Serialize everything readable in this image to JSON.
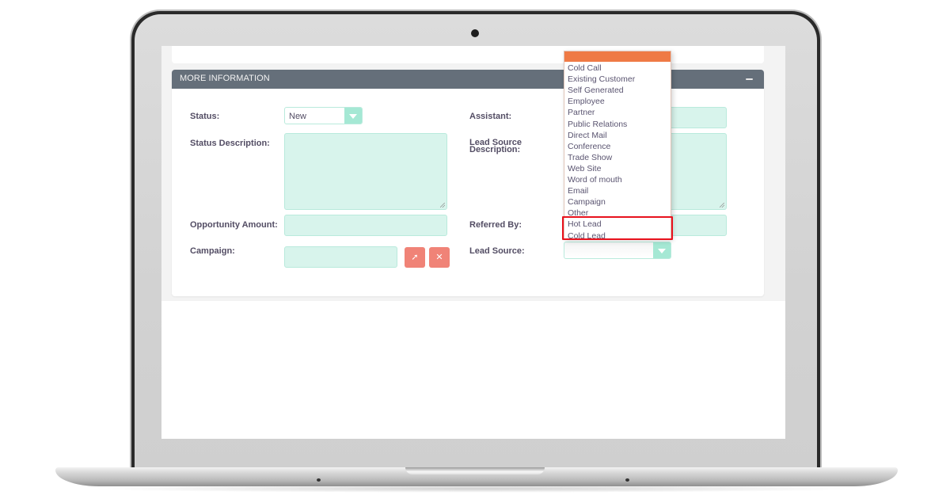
{
  "panel": {
    "title": "MORE INFORMATION",
    "collapse_icon": "minus-icon"
  },
  "fields": {
    "status": {
      "label": "Status:",
      "value": "New"
    },
    "status_description": {
      "label": "Status Description:",
      "value": ""
    },
    "opportunity_amount": {
      "label": "Opportunity Amount:",
      "value": ""
    },
    "campaign": {
      "label": "Campaign:",
      "value": "",
      "select_icon": "arrow-cursor-icon",
      "clear_icon": "close-icon",
      "select_glyph": "➚",
      "clear_glyph": "✕"
    },
    "assistant": {
      "label": "Assistant:",
      "value": ""
    },
    "lead_source_description": {
      "label": "Lead Source Description:",
      "value": ""
    },
    "referred_by": {
      "label": "Referred By:",
      "value": ""
    },
    "lead_source": {
      "label": "Lead Source:",
      "value": ""
    }
  },
  "lead_source_dropdown": {
    "options": [
      "Cold Call",
      "Existing Customer",
      "Self Generated",
      "Employee",
      "Partner",
      "Public Relations",
      "Direct Mail",
      "Conference",
      "Trade Show",
      "Web Site",
      "Word of mouth",
      "Email",
      "Campaign",
      "Other",
      "Hot Lead",
      "Cold Lead"
    ],
    "highlighted_options": [
      "Hot Lead",
      "Cold Lead"
    ]
  },
  "colors": {
    "header_bg": "#656f7a",
    "field_bg": "#d8f4ec",
    "accent_teal": "#a5e8d4",
    "button_red": "#f08377",
    "dropdown_header": "#ef7a45",
    "highlight_border": "#e8121d"
  }
}
